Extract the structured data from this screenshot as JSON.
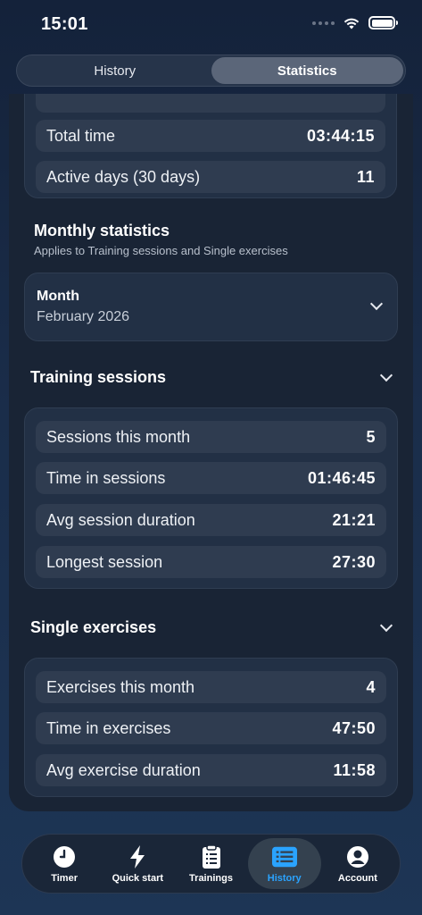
{
  "status": {
    "time": "15:01"
  },
  "segments": {
    "history": "History",
    "statistics": "Statistics"
  },
  "overview": {
    "total_time": {
      "label": "Total time",
      "value": "03:44:15"
    },
    "active_days": {
      "label": "Active days (30 days)",
      "value": "11"
    }
  },
  "monthly": {
    "title": "Monthly statistics",
    "subtitle": "Applies to Training sessions and Single exercises",
    "month_label": "Month",
    "month_value": "February 2026"
  },
  "training_sessions": {
    "title": "Training sessions",
    "rows": [
      {
        "label": "Sessions this month",
        "value": "5"
      },
      {
        "label": "Time in sessions",
        "value": "01:46:45"
      },
      {
        "label": "Avg session duration",
        "value": "21:21"
      },
      {
        "label": "Longest session",
        "value": "27:30"
      }
    ]
  },
  "single_exercises": {
    "title": "Single exercises",
    "rows": [
      {
        "label": "Exercises this month",
        "value": "4"
      },
      {
        "label": "Time in exercises",
        "value": "47:50"
      },
      {
        "label": "Avg exercise duration",
        "value": "11:58"
      }
    ]
  },
  "tabs": {
    "timer": "Timer",
    "quick_start": "Quick start",
    "trainings": "Trainings",
    "history": "History",
    "account": "Account"
  },
  "colors": {
    "accent": "#2aa3ff",
    "background": "#192435",
    "card": "#223045",
    "row": "#2f3c50"
  },
  "icons": {
    "timer": "clock-icon",
    "quick_start": "bolt-icon",
    "trainings": "clipboard-icon",
    "history": "list-icon",
    "account": "user-icon"
  }
}
